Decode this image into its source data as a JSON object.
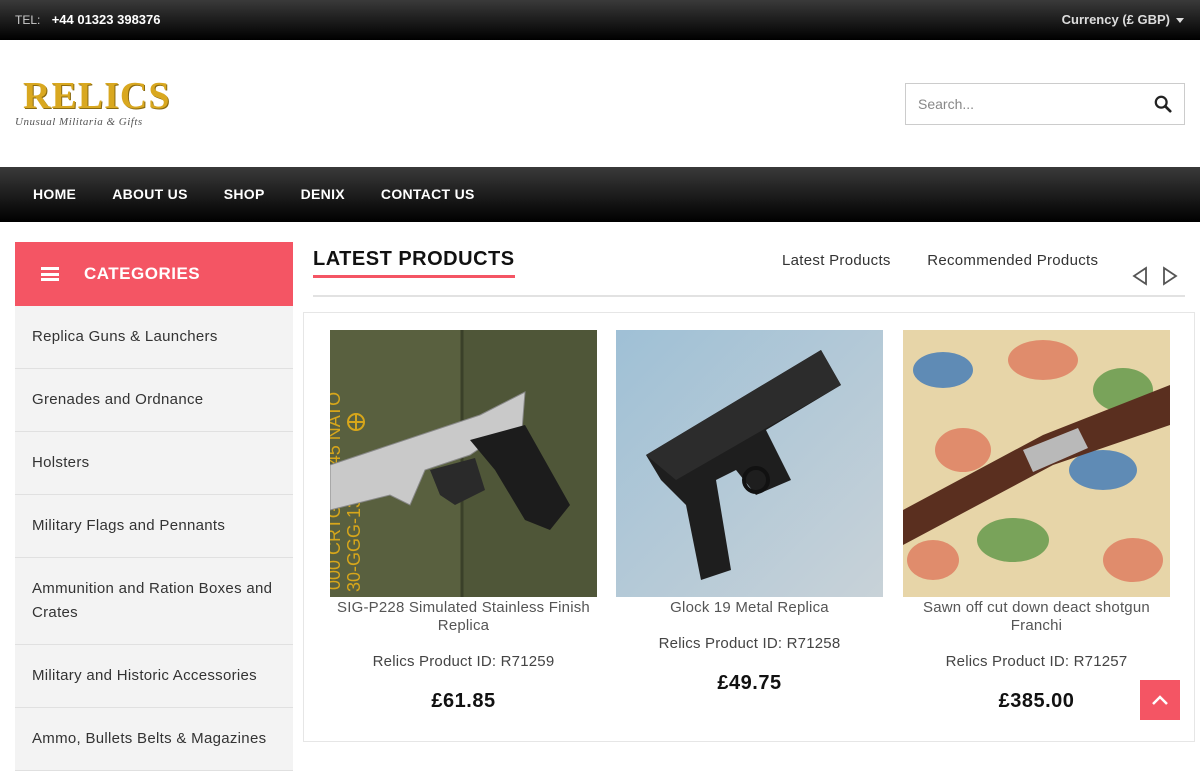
{
  "topbar": {
    "tel_label": "TEL:",
    "tel_number": "+44 01323 398376",
    "currency": "Currency (£ GBP)"
  },
  "logo": {
    "brand": "RELICS",
    "tagline": "Unusual Militaria & Gifts"
  },
  "search": {
    "placeholder": "Search..."
  },
  "nav": {
    "items": [
      "HOME",
      "ABOUT US",
      "SHOP",
      "DENIX",
      "CONTACT US"
    ]
  },
  "sidebar": {
    "title": "CATEGORIES",
    "categories": [
      "Replica Guns & Launchers",
      "Grenades and Ordnance",
      "Holsters",
      "Military Flags and Pennants",
      "Ammunition and Ration Boxes and Crates",
      "Military and Historic Accessories",
      "Ammo, Bullets Belts & Magazines"
    ]
  },
  "main": {
    "title": "LATEST PRODUCTS",
    "tabs": [
      "Latest Products",
      "Recommended Products"
    ],
    "products": [
      {
        "name": "SIG-P228 Simulated Stainless Finish Replica",
        "pid": "Relics Product ID: R71259",
        "price": "£61.85",
        "image": "silver-pistol-on-ammo-crate"
      },
      {
        "name": "Glock 19 Metal Replica",
        "pid": "Relics Product ID: R71258",
        "price": "£49.75",
        "image": "black-pistol"
      },
      {
        "name": "Sawn off cut down deact shotgun Franchi",
        "pid": "Relics Product ID: R71257",
        "price": "£385.00",
        "image": "shotgun-on-camo"
      }
    ]
  },
  "colors": {
    "accent": "#f45564",
    "nav_bg": "#000000",
    "logo_gold": "#d9a820"
  }
}
